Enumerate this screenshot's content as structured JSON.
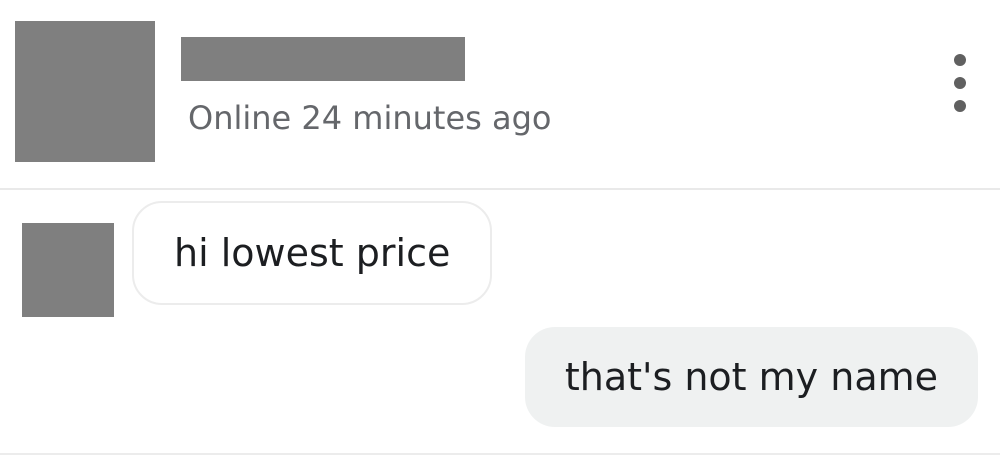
{
  "header": {
    "status": "Online 24 minutes ago",
    "menu_icon": "more-vertical-icon"
  },
  "messages": [
    {
      "direction": "incoming",
      "text": "hi lowest price"
    },
    {
      "direction": "outgoing",
      "text": "that's not my name"
    }
  ],
  "colors": {
    "redaction": "#7f7f7f",
    "status_text": "#65676b",
    "outgoing_bubble": "#eff1f1",
    "incoming_bubble_border": "#ececec"
  }
}
